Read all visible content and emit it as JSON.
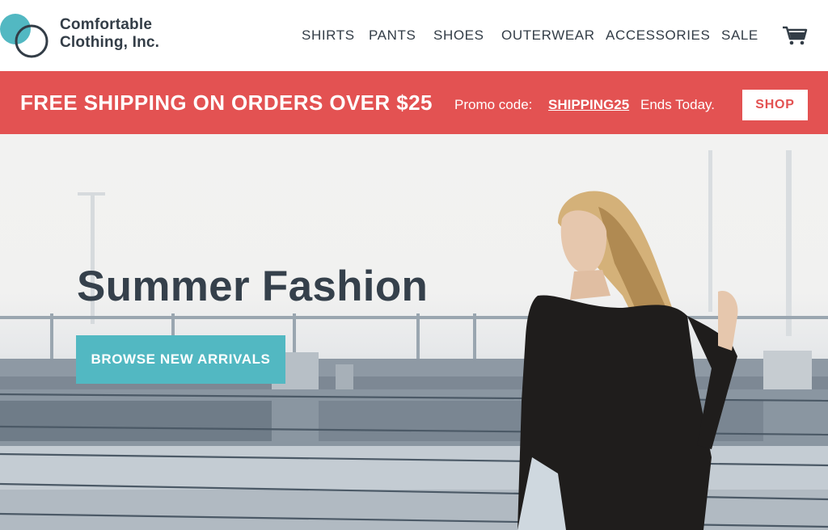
{
  "brand": {
    "line1": "Comfortable",
    "line2": "Clothing, Inc.",
    "logo_icon": "two-overlapping-circles-logo",
    "colors": {
      "teal": "#52b8c2",
      "dark": "#333d47"
    }
  },
  "nav": {
    "items": [
      "SHIRTS",
      "PANTS",
      "SHOES",
      "OUTERWEAR",
      "ACCESSORIES",
      "SALE"
    ],
    "cart_icon": "shopping-cart-icon"
  },
  "promo": {
    "headline": "FREE SHIPPING ON ORDERS OVER $25",
    "code_prefix": "Promo code:",
    "code": "SHIPPING25",
    "ends": "Ends Today.",
    "button_label": "SHOP",
    "background": "#e35252"
  },
  "hero": {
    "title": "Summer Fashion",
    "button_label": "BROWSE NEW ARRIVALS",
    "button_color": "#52b8c2",
    "image": "woman-in-black-top-on-parking-deck-photo"
  }
}
